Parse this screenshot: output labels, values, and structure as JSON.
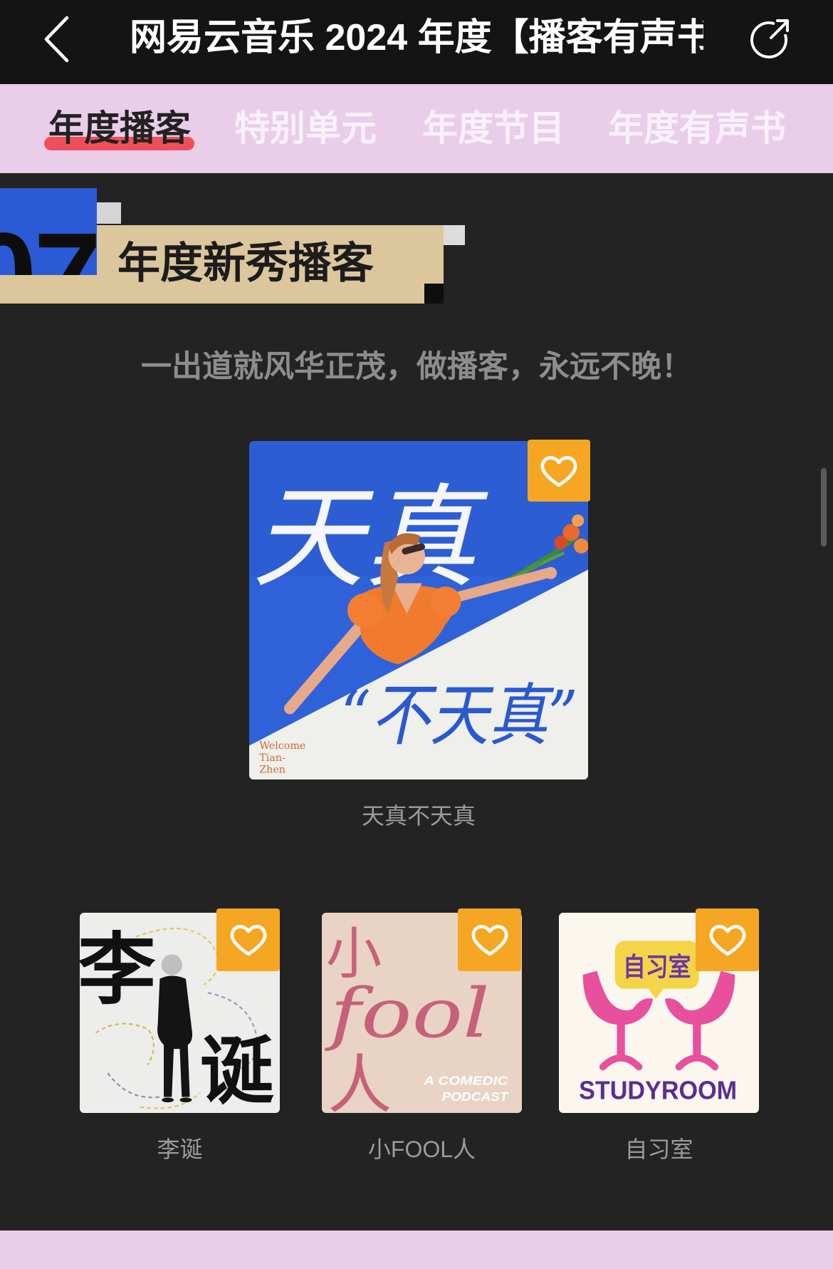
{
  "header": {
    "back_icon": "chevron-left-icon",
    "title": "网易云音乐 2024 年度【播客有声书",
    "share_icon": "share-icon"
  },
  "tabs": [
    {
      "label": "年度播客",
      "active": true
    },
    {
      "label": "特别单元",
      "active": false
    },
    {
      "label": "年度节目",
      "active": false
    },
    {
      "label": "年度有声书",
      "active": false
    }
  ],
  "section": {
    "number": "07",
    "title": "年度新秀播客",
    "subtitle": "一出道就风华正茂，做播客，永远不晚！"
  },
  "featured": {
    "name": "天真不天真",
    "favorite_icon": "heart-icon",
    "cover": {
      "headline": "天真",
      "quote": "“不天真”",
      "welcome_lines": [
        "Welcome",
        "Tian-",
        "Zhen"
      ]
    }
  },
  "podcasts": [
    {
      "name": "李诞",
      "favorite_icon": "heart-icon",
      "cover": {
        "top_char": "李",
        "bottom_char": "诞"
      }
    },
    {
      "name": "小FOOL人",
      "favorite_icon": "heart-icon",
      "cover": {
        "top_char": "小",
        "middle_word": "fool",
        "bottom_char": "人",
        "tagline": [
          "A COMEDIC",
          "PODCAST"
        ]
      }
    },
    {
      "name": "自习室",
      "favorite_icon": "heart-icon",
      "cover": {
        "bubble_text": "自习室",
        "wordmark": "STUDYROOM"
      }
    }
  ],
  "colors": {
    "header_bg": "#141414",
    "tab_bar_bg": "#e9cde9",
    "active_tab_underline": "#ef4f5b",
    "page_bg": "#232323",
    "section_block_blue": "#2b5ad6",
    "section_banner": "#dcc69c",
    "favorite_badge": "#f5a623"
  }
}
